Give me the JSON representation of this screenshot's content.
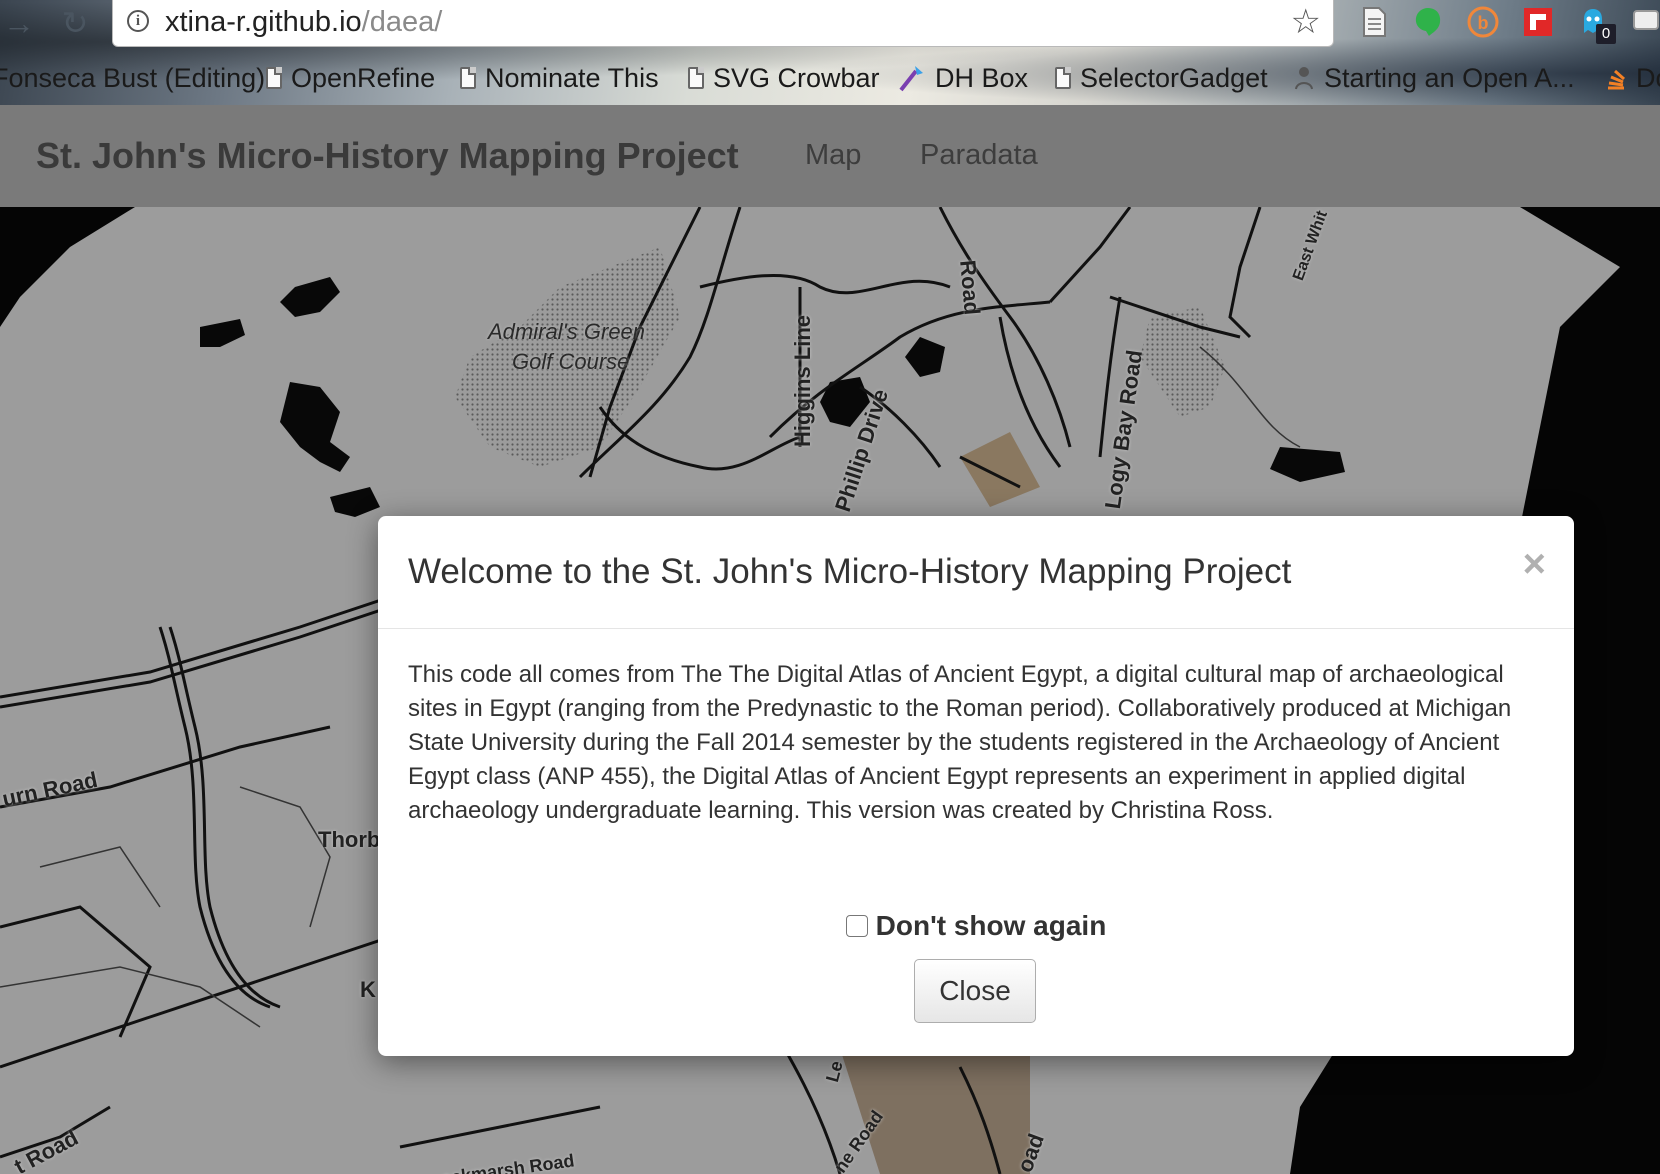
{
  "browser": {
    "url_host": "xtina-r.github.io",
    "url_path": "/daea/",
    "extension_badge": "0",
    "bookmarks": [
      {
        "label": "Fonseca Bust (Editing)"
      },
      {
        "label": "OpenRefine"
      },
      {
        "label": "Nominate This"
      },
      {
        "label": "SVG Crowbar"
      },
      {
        "label": "DH Box"
      },
      {
        "label": "SelectorGadget"
      },
      {
        "label": "Starting an Open A..."
      },
      {
        "label": "Do"
      }
    ]
  },
  "navbar": {
    "brand": "St. John's Micro-History Mapping Project",
    "links": [
      "Map",
      "Paradata"
    ]
  },
  "map": {
    "labels": {
      "golf_line1": "Admiral's Green",
      "golf_line2": "Golf Course",
      "higgins": "Higgins Line",
      "phillip": "Phillip Drive",
      "logy_bay": "Logy Bay Road",
      "road_top": "Road",
      "east_white": "East Whit",
      "burn_road": "urn Road",
      "thorb": "Thorb",
      "road_bottom": "t Road",
      "blackmarsh": "ackmarsh Road",
      "k": "K",
      "le": "Le",
      "ne_road": "ne Road",
      "oad": "oad"
    }
  },
  "modal": {
    "title": "Welcome to the St. John's Micro-History Mapping Project",
    "close_x": "×",
    "body": "This code all comes from The The Digital Atlas of Ancient Egypt, a digital cultural map of archaeological sites in Egypt (ranging from the Predynastic to the Roman period). Collaboratively produced at Michigan State University during the Fall 2014 semester by the students registered in the Archaeology of Ancient Egypt class (ANP 455), the Digital Atlas of Ancient Egypt represents an experiment in applied digital archaeology undergraduate learning. This version was created by Christina Ross.",
    "dont_show_label": "Don't show again",
    "dont_show_checked": false,
    "close_button": "Close"
  }
}
